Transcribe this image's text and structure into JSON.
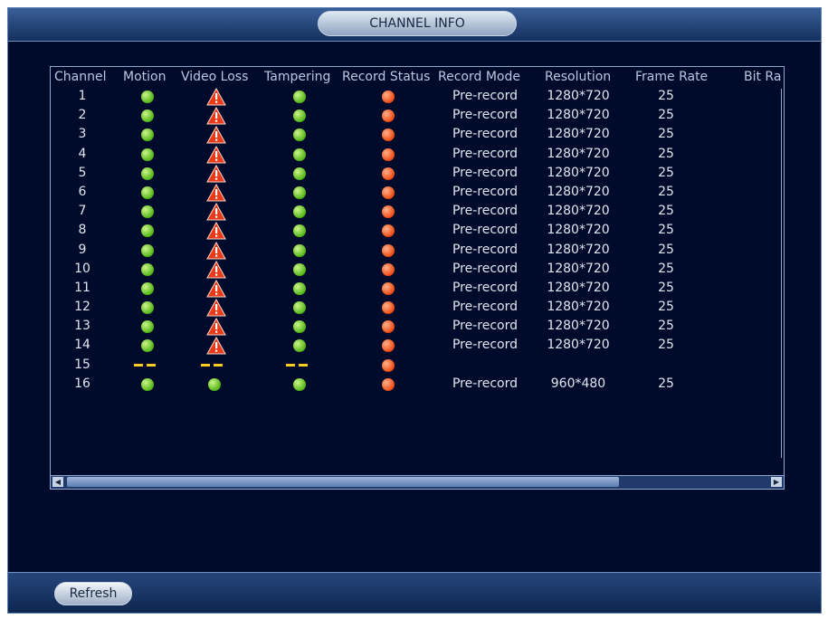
{
  "window": {
    "title": "CHANNEL INFO"
  },
  "table": {
    "columns": [
      "Channel",
      "Motion",
      "Video Loss",
      "Tampering",
      "Record Status",
      "Record Mode",
      "Resolution",
      "Frame Rate",
      "Bit Ra"
    ],
    "rows": [
      {
        "channel": "1",
        "motion": "green",
        "video_loss": "warning",
        "tampering": "green",
        "record_status": "red",
        "record_mode": "Pre-record",
        "resolution": "1280*720",
        "frame_rate": "25"
      },
      {
        "channel": "2",
        "motion": "green",
        "video_loss": "warning",
        "tampering": "green",
        "record_status": "red",
        "record_mode": "Pre-record",
        "resolution": "1280*720",
        "frame_rate": "25"
      },
      {
        "channel": "3",
        "motion": "green",
        "video_loss": "warning",
        "tampering": "green",
        "record_status": "red",
        "record_mode": "Pre-record",
        "resolution": "1280*720",
        "frame_rate": "25"
      },
      {
        "channel": "4",
        "motion": "green",
        "video_loss": "warning",
        "tampering": "green",
        "record_status": "red",
        "record_mode": "Pre-record",
        "resolution": "1280*720",
        "frame_rate": "25"
      },
      {
        "channel": "5",
        "motion": "green",
        "video_loss": "warning",
        "tampering": "green",
        "record_status": "red",
        "record_mode": "Pre-record",
        "resolution": "1280*720",
        "frame_rate": "25"
      },
      {
        "channel": "6",
        "motion": "green",
        "video_loss": "warning",
        "tampering": "green",
        "record_status": "red",
        "record_mode": "Pre-record",
        "resolution": "1280*720",
        "frame_rate": "25"
      },
      {
        "channel": "7",
        "motion": "green",
        "video_loss": "warning",
        "tampering": "green",
        "record_status": "red",
        "record_mode": "Pre-record",
        "resolution": "1280*720",
        "frame_rate": "25"
      },
      {
        "channel": "8",
        "motion": "green",
        "video_loss": "warning",
        "tampering": "green",
        "record_status": "red",
        "record_mode": "Pre-record",
        "resolution": "1280*720",
        "frame_rate": "25"
      },
      {
        "channel": "9",
        "motion": "green",
        "video_loss": "warning",
        "tampering": "green",
        "record_status": "red",
        "record_mode": "Pre-record",
        "resolution": "1280*720",
        "frame_rate": "25"
      },
      {
        "channel": "10",
        "motion": "green",
        "video_loss": "warning",
        "tampering": "green",
        "record_status": "red",
        "record_mode": "Pre-record",
        "resolution": "1280*720",
        "frame_rate": "25"
      },
      {
        "channel": "11",
        "motion": "green",
        "video_loss": "warning",
        "tampering": "green",
        "record_status": "red",
        "record_mode": "Pre-record",
        "resolution": "1280*720",
        "frame_rate": "25"
      },
      {
        "channel": "12",
        "motion": "green",
        "video_loss": "warning",
        "tampering": "green",
        "record_status": "red",
        "record_mode": "Pre-record",
        "resolution": "1280*720",
        "frame_rate": "25"
      },
      {
        "channel": "13",
        "motion": "green",
        "video_loss": "warning",
        "tampering": "green",
        "record_status": "red",
        "record_mode": "Pre-record",
        "resolution": "1280*720",
        "frame_rate": "25"
      },
      {
        "channel": "14",
        "motion": "green",
        "video_loss": "warning",
        "tampering": "green",
        "record_status": "red",
        "record_mode": "Pre-record",
        "resolution": "1280*720",
        "frame_rate": "25"
      },
      {
        "channel": "15",
        "motion": "none",
        "video_loss": "none",
        "tampering": "none",
        "record_status": "red",
        "record_mode": "",
        "resolution": "",
        "frame_rate": ""
      },
      {
        "channel": "16",
        "motion": "green",
        "video_loss": "green",
        "tampering": "green",
        "record_status": "red",
        "record_mode": "Pre-record",
        "resolution": "960*480",
        "frame_rate": "25"
      }
    ]
  },
  "footer": {
    "refresh_label": "Refresh"
  },
  "colors": {
    "status_ok": "#52b516",
    "status_recording": "#ef4a12",
    "status_none": "#ffcc22"
  }
}
